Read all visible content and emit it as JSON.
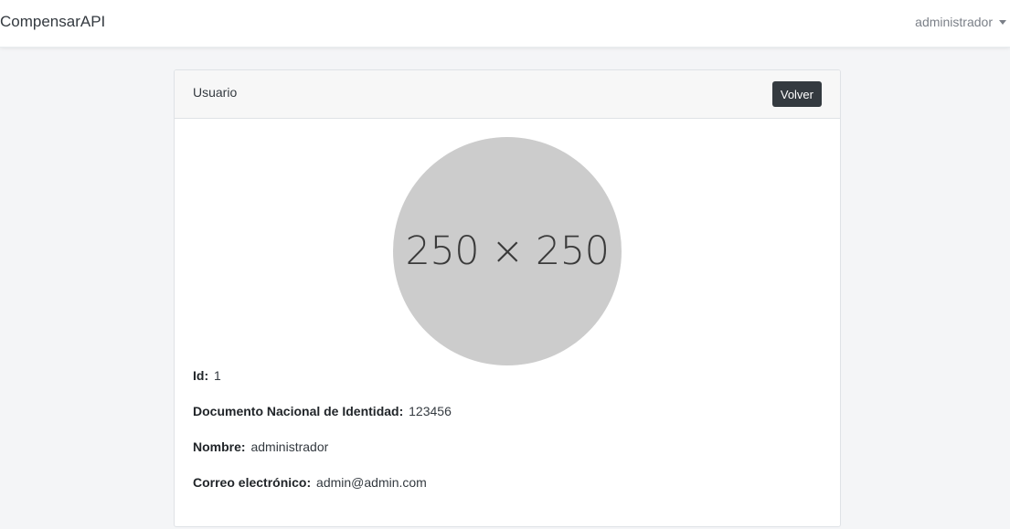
{
  "navbar": {
    "brand": "CompensarAPI",
    "user_menu_label": "administrador"
  },
  "card": {
    "title": "Usuario",
    "back_button_label": "Volver",
    "avatar_placeholder": "250 × 250",
    "fields": [
      {
        "label": "Id:",
        "value": "1"
      },
      {
        "label": "Documento Nacional de Identidad:",
        "value": "123456"
      },
      {
        "label": "Nombre:",
        "value": "administrador"
      },
      {
        "label": "Correo electrónico:",
        "value": "admin@admin.com"
      }
    ]
  },
  "colors": {
    "page_background": "#f4f5f7",
    "button_background": "#343a40",
    "avatar_background": "#cccccc"
  }
}
